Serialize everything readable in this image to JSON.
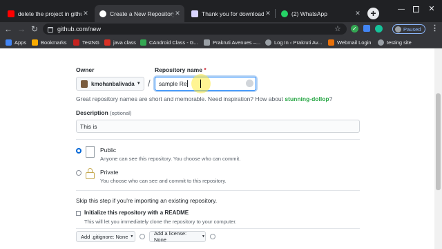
{
  "browser": {
    "tabs": [
      {
        "title": "delete the project in github",
        "icon": "youtube-icon",
        "color": "#ff0000"
      },
      {
        "title": "Create a New Repository",
        "icon": "github-icon",
        "color": "#ffffff"
      },
      {
        "title": "Thank you for downloading E",
        "icon": "eclipse-icon",
        "color": "#2c2255"
      },
      {
        "title": "(2) WhatsApp",
        "icon": "whatsapp-icon",
        "color": "#25d366"
      }
    ],
    "new_tab_symbol": "+",
    "url": "github.com/new",
    "profile_label": "Paused",
    "bookmarks": [
      {
        "label": "Apps",
        "color": "#4285f4"
      },
      {
        "label": "Bookmarks",
        "color": "#f9ab00"
      },
      {
        "label": "TestNG",
        "color": "#c5221f"
      },
      {
        "label": "java class",
        "color": "#d93025"
      },
      {
        "label": "CAndroid Class - G...",
        "color": "#34a853"
      },
      {
        "label": "Prakruti Avenues –...",
        "color": "#9aa0a6"
      },
      {
        "label": "Log In ‹ Prakruti Av...",
        "color": "#9aa0a6"
      },
      {
        "label": "Webmail Login",
        "color": "#e8710a"
      },
      {
        "label": "testing site",
        "color": "#9aa0a6"
      }
    ]
  },
  "form": {
    "owner_label": "Owner",
    "owner_value": "kmohanbalivada",
    "separator": "/",
    "repo_label": "Repository name",
    "required_mark": "*",
    "repo_value": "sample Re",
    "hint_text": "Great repository names are short and memorable. Need inspiration? How about",
    "suggestion": "stunning-dollop",
    "hint_end": "?",
    "description_label": "Description",
    "optional_label": "(optional)",
    "description_value": "This is",
    "public_label": "Public",
    "public_desc": "Anyone can see this repository. You choose who can commit.",
    "private_label": "Private",
    "private_desc": "You choose who can see and commit to this repository.",
    "skip_text": "Skip this step if you're importing an existing repository.",
    "readme_label": "Initialize this repository with a README",
    "readme_desc": "This will let you immediately clone the repository to your computer.",
    "gitignore_label": "Add .gitignore: None",
    "license_label": "Add a license: None"
  }
}
